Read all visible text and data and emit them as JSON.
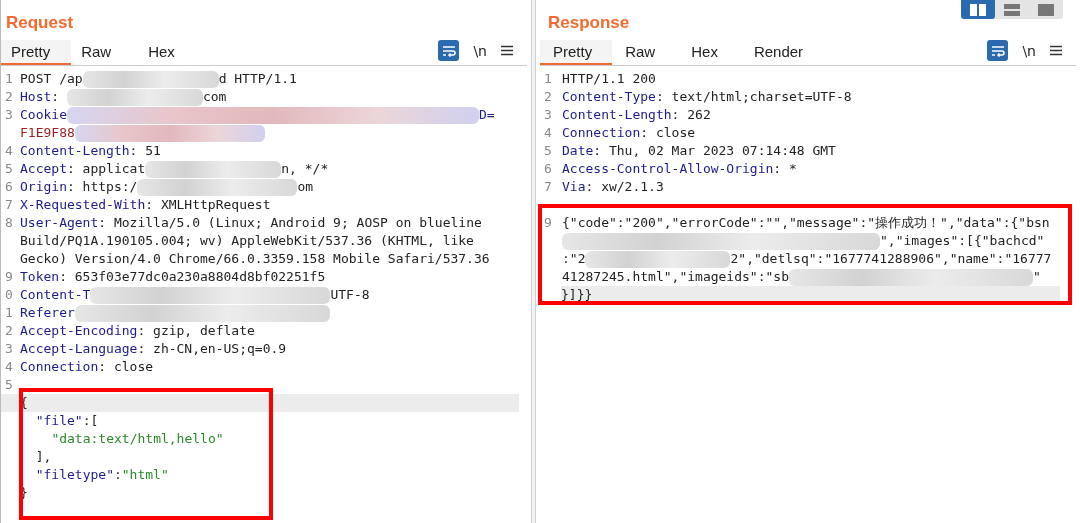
{
  "layout_toggle": [
    {
      "selected": true
    },
    {
      "selected": false
    },
    {
      "selected": false
    }
  ],
  "panes": [
    {
      "title": "Request",
      "tabs": [
        {
          "label": "Pretty",
          "selected": true
        },
        {
          "label": "Raw",
          "selected": false
        },
        {
          "label": "Hex",
          "selected": false
        }
      ],
      "toolbar": {
        "wrap_on": true,
        "newline_label": "\\n"
      },
      "lines": [
        {
          "number": "1",
          "segments": [
            {
              "kind": "text",
              "text": "POST /ap"
            },
            {
              "kind": "redacted"
            },
            {
              "kind": "text",
              "text": "d HTTP/1.1"
            }
          ]
        },
        {
          "number": "2",
          "segments": [
            {
              "kind": "key",
              "text": "Host"
            },
            {
              "kind": "text",
              "text": ": "
            },
            {
              "kind": "redacted"
            },
            {
              "kind": "text",
              "text": "com"
            }
          ]
        },
        {
          "number": "3",
          "segments": [
            {
              "kind": "key",
              "text": "Cookie"
            },
            {
              "kind": "redacted"
            },
            {
              "kind": "key",
              "text": "D="
            }
          ]
        },
        {
          "segments": [
            {
              "kind": "cookie",
              "text": "F1E9F88"
            },
            {
              "kind": "redacted"
            }
          ]
        },
        {
          "number": "4",
          "segments": [
            {
              "kind": "key",
              "text": "Content-Length"
            },
            {
              "kind": "text",
              "text": ": 51"
            }
          ]
        },
        {
          "number": "5",
          "segments": [
            {
              "kind": "key",
              "text": "Accept"
            },
            {
              "kind": "text",
              "text": ": applicat"
            },
            {
              "kind": "redacted"
            },
            {
              "kind": "text",
              "text": "n, */*"
            }
          ]
        },
        {
          "number": "6",
          "segments": [
            {
              "kind": "key",
              "text": "Origin"
            },
            {
              "kind": "text",
              "text": ": https:/"
            },
            {
              "kind": "redacted"
            },
            {
              "kind": "text",
              "text": "om"
            }
          ]
        },
        {
          "number": "7",
          "segments": [
            {
              "kind": "key",
              "text": "X-Requested-With"
            },
            {
              "kind": "text",
              "text": ": XMLHttpRequest"
            }
          ]
        },
        {
          "number": "8",
          "segments": [
            {
              "kind": "key",
              "text": "User-Agent"
            },
            {
              "kind": "text",
              "text": ": Mozilla/5.0 (Linux; Android 9; AOSP on blueline"
            }
          ]
        },
        {
          "segments": [
            {
              "kind": "text",
              "text": "Build/PQ1A.190105.004; wv) AppleWebKit/537.36 (KHTML, like"
            }
          ]
        },
        {
          "segments": [
            {
              "kind": "text",
              "text": "Gecko) Version/4.0 Chrome/66.0.3359.158 Mobile Safari/537.36"
            }
          ]
        },
        {
          "number": "9",
          "segments": [
            {
              "kind": "key",
              "text": "Token"
            },
            {
              "kind": "text",
              "text": ": 653f03e77dc0a230a8804d8bf02251f5"
            }
          ]
        },
        {
          "number": "0",
          "segments": [
            {
              "kind": "key",
              "text": "Content-T"
            },
            {
              "kind": "redacted"
            },
            {
              "kind": "text",
              "text": "UTF-8"
            }
          ]
        },
        {
          "number": "1",
          "segments": [
            {
              "kind": "key",
              "text": "Referer"
            },
            {
              "kind": "redacted"
            }
          ]
        },
        {
          "number": "2",
          "segments": [
            {
              "kind": "key",
              "text": "Accept-Encoding"
            },
            {
              "kind": "text",
              "text": ": gzip, deflate"
            }
          ]
        },
        {
          "number": "3",
          "segments": [
            {
              "kind": "key",
              "text": "Accept-Language"
            },
            {
              "kind": "text",
              "text": ": zh-CN,en-US;q=0.9"
            }
          ]
        },
        {
          "number": "4",
          "segments": [
            {
              "kind": "key",
              "text": "Connection"
            },
            {
              "kind": "text",
              "text": ": close"
            }
          ]
        },
        {
          "number": "5"
        }
      ],
      "body": {
        "framed": true,
        "lines": [
          {
            "current": true,
            "segments": [
              {
                "kind": "text",
                "text": "{"
              }
            ],
            "children": [
              {
                "current": false,
                "segments": [
                  {
                    "kind": "key",
                    "text": "\"file\""
                  },
                  {
                    "kind": "text",
                    "text": ":["
                  }
                ],
                "children": [
                  {
                    "current": false,
                    "segments": [
                      {
                        "kind": "string",
                        "text": "\"data:text/html,hello\""
                      }
                    ]
                  }
                ]
              },
              {
                "current": false,
                "segments": [
                  {
                    "kind": "text",
                    "text": "],"
                  }
                ]
              },
              {
                "current": false,
                "segments": [
                  {
                    "kind": "key",
                    "text": "\"filetype\""
                  },
                  {
                    "kind": "text",
                    "text": ":"
                  },
                  {
                    "kind": "string",
                    "text": "\"html\""
                  }
                ]
              }
            ]
          },
          {
            "current": false,
            "segments": [
              {
                "kind": "text",
                "text": "}"
              }
            ]
          }
        ]
      }
    },
    {
      "title": "Response",
      "tabs": [
        {
          "label": "Pretty",
          "selected": true
        },
        {
          "label": "Raw",
          "selected": false
        },
        {
          "label": "Hex",
          "selected": false
        },
        {
          "label": "Render",
          "selected": false
        }
      ],
      "toolbar": {
        "wrap_on": true,
        "newline_label": "\\n"
      },
      "lines": [
        {
          "number": "1",
          "segments": [
            {
              "kind": "text",
              "text": "HTTP/1.1 200"
            }
          ]
        },
        {
          "number": "2",
          "segments": [
            {
              "kind": "key",
              "text": "Content-Type"
            },
            {
              "kind": "text",
              "text": ": text/html;charset=UTF-8"
            }
          ]
        },
        {
          "number": "3",
          "segments": [
            {
              "kind": "key",
              "text": "Content-Length"
            },
            {
              "kind": "text",
              "text": ": 262"
            }
          ]
        },
        {
          "number": "4",
          "segments": [
            {
              "kind": "key",
              "text": "Connection"
            },
            {
              "kind": "text",
              "text": ": close"
            }
          ]
        },
        {
          "number": "5",
          "segments": [
            {
              "kind": "key",
              "text": "Date"
            },
            {
              "kind": "text",
              "text": ": Thu, 02 Mar 2023 07:14:48 GMT"
            }
          ]
        },
        {
          "number": "6",
          "segments": [
            {
              "kind": "key",
              "text": "Access-Control-Allow-Origin"
            },
            {
              "kind": "text",
              "text": ": *"
            }
          ]
        },
        {
          "number": "7",
          "segments": [
            {
              "kind": "key",
              "text": "Via"
            },
            {
              "kind": "text",
              "text": ": xw/2.1.3"
            }
          ]
        }
      ],
      "body": {
        "framed": true,
        "lines": [
          {
            "number": "9",
            "current": false,
            "segments": [
              {
                "kind": "text",
                "text": "{\"code\":\"200\",\"errorCode\":\"\",\"message\":\"操作成功！\",\"data\":{\"bsn"
              }
            ]
          },
          {
            "current": false,
            "segments": [
              {
                "kind": "redacted"
              },
              {
                "kind": "text",
                "text": "\",\"images\":[{\"bachcd\""
              }
            ]
          },
          {
            "current": false,
            "segments": [
              {
                "kind": "text",
                "text": ":\"2"
              },
              {
                "kind": "redacted"
              },
              {
                "kind": "text",
                "text": "2\",\"detlsq\":\"1677741288906\",\"name\":\"16777"
              }
            ]
          },
          {
            "current": false,
            "segments": [
              {
                "kind": "text",
                "text": "41287245.html\",\"imageids\":\"sb"
              },
              {
                "kind": "redacted"
              },
              {
                "kind": "text",
                "text": "\""
              }
            ]
          },
          {
            "current": true,
            "segments": [
              {
                "kind": "text",
                "text": "}]}}"
              }
            ]
          }
        ]
      }
    }
  ]
}
